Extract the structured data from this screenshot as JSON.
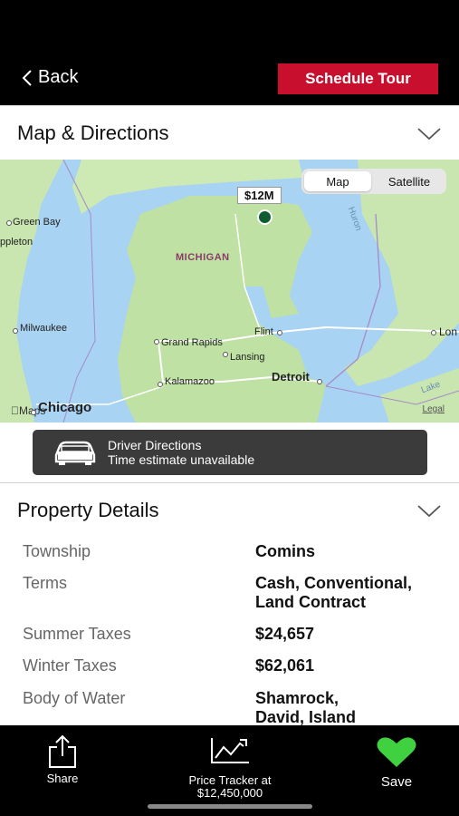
{
  "header": {
    "back_label": "Back",
    "tour_label": "Schedule Tour",
    "tour_color": "#c8102e"
  },
  "map_section": {
    "title": "Map & Directions",
    "map_toggle": {
      "selected": "Map",
      "other": "Satellite"
    },
    "price_pin": "$12M",
    "labels": {
      "green_bay": "Green Bay",
      "appleton": "ppleton",
      "michigan": "MICHIGAN",
      "milwaukee": "Milwaukee",
      "grand_rapids": "Grand Rapids",
      "flint": "Flint",
      "lansing": "Lansing",
      "detroit": "Detroit",
      "kalamazoo": "Kalamazoo",
      "chicago": "Chicago",
      "london": "Lon",
      "lake_huron": "Huron",
      "lake_erie": "Lake",
      "apple_maps": "Maps",
      "legal": "Legal"
    }
  },
  "driver_directions": {
    "line1": "Driver Directions",
    "line2": "Time estimate unavailable"
  },
  "property_section": {
    "title": "Property Details",
    "rows": [
      {
        "key": "Township",
        "value": "Comins"
      },
      {
        "key": "Terms",
        "value": "Cash, Conventional, Land Contract"
      },
      {
        "key": "Summer Taxes",
        "value": "$24,657"
      },
      {
        "key": "Winter Taxes",
        "value": "$62,061"
      },
      {
        "key": "Body of Water",
        "value": "Shamrock, David, Island"
      }
    ]
  },
  "tabbar": {
    "share_label": "Share",
    "price_tracker_line1": "Price Tracker at",
    "price_tracker_line2": "$12,450,000",
    "save_label": "Save",
    "save_color": "#3fd13f"
  }
}
